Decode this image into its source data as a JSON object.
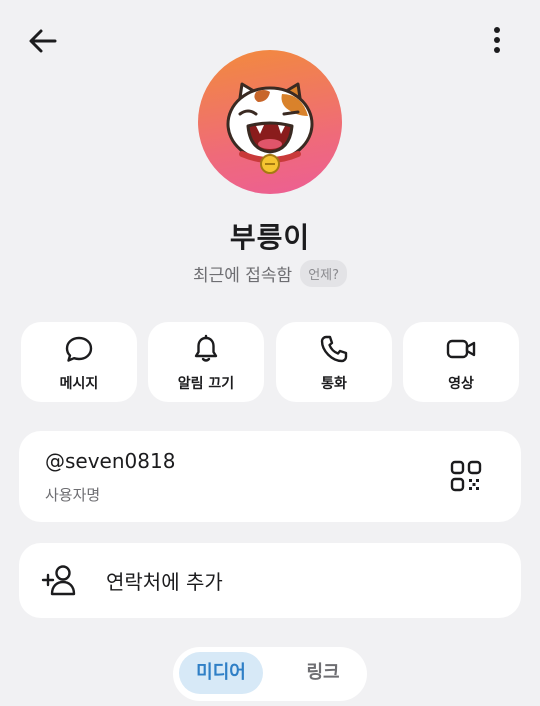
{
  "header": {
    "back_icon": "arrow-left-icon",
    "more_icon": "more-vertical-icon"
  },
  "profile": {
    "name": "부릉이",
    "status": "최근에 접속함",
    "status_help": "언제?",
    "avatar": "calico-cat-sticker-avatar",
    "avatar_gradient": [
      "#f28b3c",
      "#ec5e95"
    ]
  },
  "actions": [
    {
      "label": "메시지",
      "icon": "chat-bubble-icon"
    },
    {
      "label": "알림 끄기",
      "icon": "bell-icon"
    },
    {
      "label": "통화",
      "icon": "phone-icon"
    },
    {
      "label": "영상",
      "icon": "video-camera-icon"
    }
  ],
  "username_card": {
    "username": "@seven0818",
    "label": "사용자명",
    "icon": "qr-code-icon"
  },
  "add_contact": {
    "label": "연락처에 추가",
    "icon": "add-person-icon"
  },
  "tabs": [
    {
      "label": "미디어",
      "selected": true
    },
    {
      "label": "링크",
      "selected": false
    }
  ],
  "colors": {
    "background": "#f1f1f3",
    "card": "#ffffff",
    "selected_tab_bg": "#d7e9f7",
    "selected_tab_text": "#2f7fc6"
  }
}
